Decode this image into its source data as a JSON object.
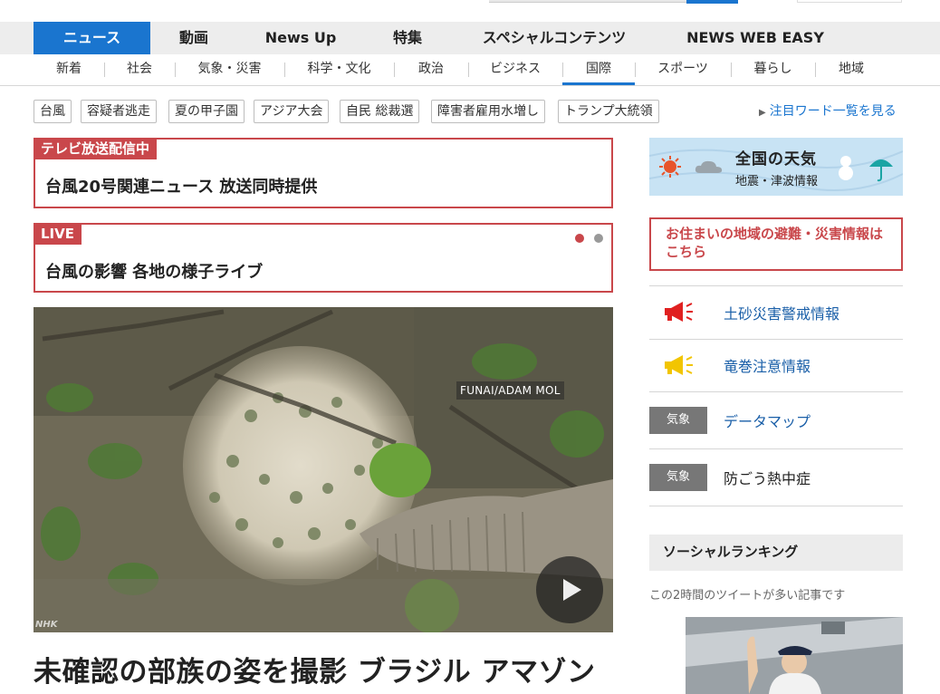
{
  "main_nav": {
    "items": [
      {
        "label": "ニュース",
        "active": true
      },
      {
        "label": "動画"
      },
      {
        "label": "News Up"
      },
      {
        "label": "特集"
      },
      {
        "label": "スペシャルコンテンツ"
      },
      {
        "label": "NEWS WEB EASY"
      }
    ]
  },
  "sub_nav": {
    "items": [
      {
        "label": "新着"
      },
      {
        "label": "社会"
      },
      {
        "label": "気象・災害"
      },
      {
        "label": "科学・文化"
      },
      {
        "label": "政治"
      },
      {
        "label": "ビジネス"
      },
      {
        "label": "国際",
        "active": true
      },
      {
        "label": "スポーツ"
      },
      {
        "label": "暮らし"
      },
      {
        "label": "地域"
      }
    ]
  },
  "tags": {
    "items": [
      "台風",
      "容疑者逃走",
      "夏の甲子園",
      "アジア大会",
      "自民 総裁選",
      "障害者雇用水増し",
      "トランプ大統領"
    ],
    "more_link": "注目ワード一覧を見る"
  },
  "broadcast": {
    "badge": "テレビ放送配信中",
    "title": "台風20号関連ニュース 放送同時提供"
  },
  "live": {
    "badge": "LIVE",
    "title": "台風の影響 各地の様子ライブ",
    "dots": {
      "count": 2,
      "active_index": 0
    }
  },
  "hero": {
    "credit": "FUNAI/ADAM MOL",
    "watermark": "NHK",
    "headline": "未確認の部族の姿を撮影 ブラジル アマゾン"
  },
  "weather": {
    "title": "全国の天気",
    "subtitle": "地震・津波情報"
  },
  "evacuation": {
    "label": "お住まいの地域の避難・災害情報はこちら"
  },
  "alerts": [
    {
      "label": "土砂災害警戒情報",
      "icon": "megaphone-icon",
      "color": "#e02020"
    },
    {
      "label": "竜巻注意情報",
      "icon": "megaphone-icon",
      "color": "#f2c500"
    },
    {
      "label": "データマップ",
      "badge": "気象"
    },
    {
      "label": "防ごう熱中症",
      "badge": "気象"
    }
  ],
  "social": {
    "heading": "ソーシャルランキング",
    "subtitle": "この2時間のツイートが多い記事です"
  },
  "colors": {
    "accent": "#1a75cf",
    "alert_red": "#c9474b",
    "link_blue": "#1a5fa8"
  }
}
